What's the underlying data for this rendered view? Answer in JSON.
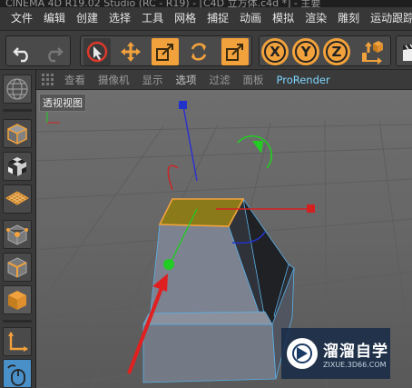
{
  "window": {
    "title": "CINEMA 4D R19.02 Studio (RC - R19) - [C4D 立方体.c4d *] - 主要"
  },
  "menubar": {
    "items": [
      {
        "label": "文件"
      },
      {
        "label": "编辑"
      },
      {
        "label": "创建"
      },
      {
        "label": "选择"
      },
      {
        "label": "工具"
      },
      {
        "label": "网格"
      },
      {
        "label": "捕捉"
      },
      {
        "label": "动画"
      },
      {
        "label": "模拟"
      },
      {
        "label": "渲染"
      },
      {
        "label": "雕刻"
      },
      {
        "label": "运动跟踪"
      }
    ]
  },
  "toolbar": {
    "axis_x": "X",
    "axis_y": "Y",
    "axis_z": "Z"
  },
  "viewport_menu": {
    "items": [
      {
        "label": "查看"
      },
      {
        "label": "摄像机"
      },
      {
        "label": "显示"
      },
      {
        "label": "选项"
      },
      {
        "label": "过滤"
      },
      {
        "label": "面板"
      },
      {
        "label": "ProRender"
      }
    ]
  },
  "viewport": {
    "label": "透视视图",
    "selected_face_color": "#8a7a1a",
    "axis_colors": {
      "x": "#d42020",
      "y": "#22cc22",
      "z": "#2233cc"
    }
  },
  "watermark": {
    "title": "溜溜自学",
    "subtitle": "ZIXUE.3D66.COM"
  },
  "colors": {
    "accent_orange": "#f2a23c",
    "arrow_red": "#e02020"
  }
}
